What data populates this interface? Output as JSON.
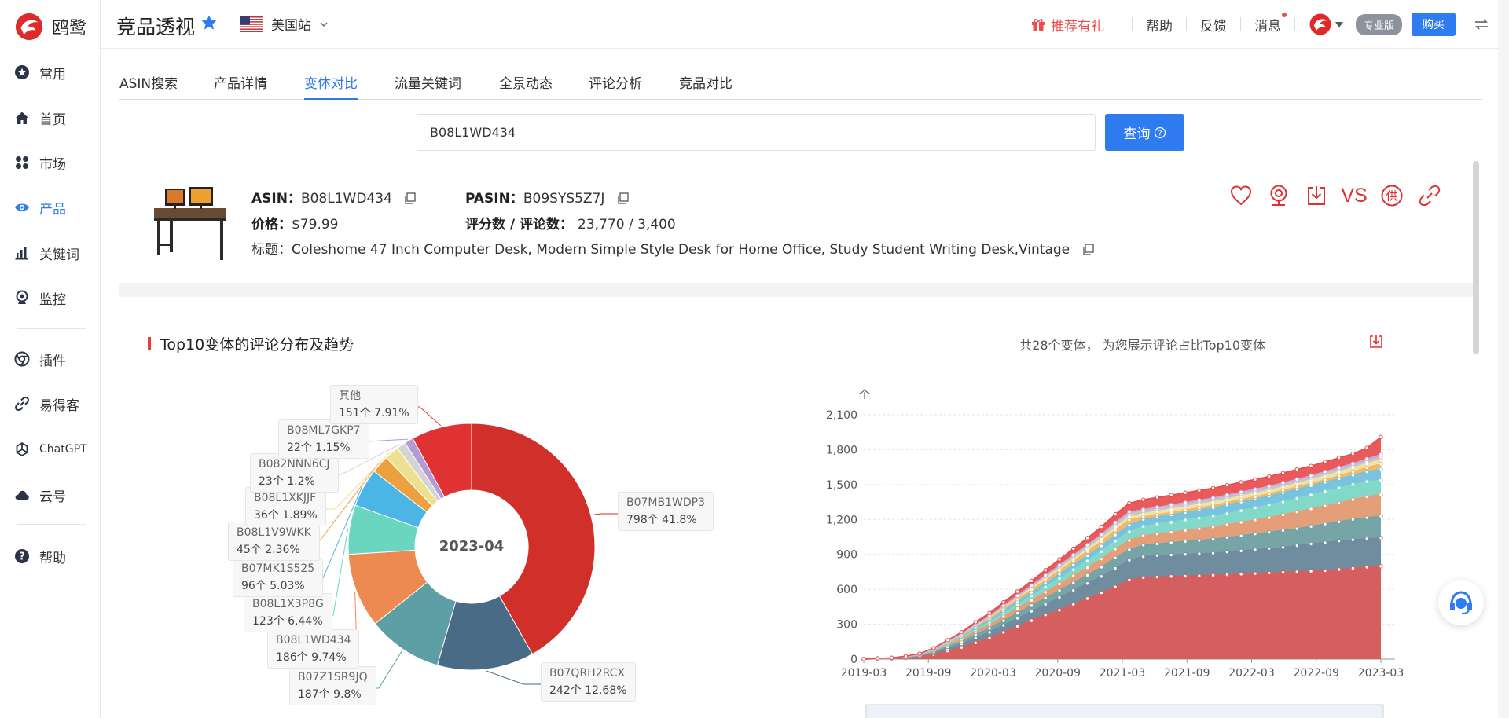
{
  "brand": {
    "name": "鸥鹭"
  },
  "sidebar": {
    "items": [
      {
        "label": "常用",
        "icon": "star-circle-icon"
      },
      {
        "label": "首页",
        "icon": "home-icon"
      },
      {
        "label": "市场",
        "icon": "grid-icon"
      },
      {
        "label": "产品",
        "icon": "eye-icon",
        "active": true
      },
      {
        "label": "关键词",
        "icon": "bar-chart-icon"
      },
      {
        "label": "监控",
        "icon": "webcam-icon"
      },
      {
        "label": "插件",
        "icon": "chrome-icon"
      },
      {
        "label": "易得客",
        "icon": "link-icon"
      },
      {
        "label": "ChatGPT",
        "icon": "openai-icon"
      },
      {
        "label": "云号",
        "icon": "cloud-icon"
      },
      {
        "label": "帮助",
        "icon": "help-icon"
      }
    ]
  },
  "header": {
    "title": "竞品透视",
    "site": "美国站",
    "gift_label": "推荐有礼",
    "help_label": "帮助",
    "feedback_label": "反馈",
    "message_label": "消息",
    "pro_badge": "专业版",
    "buy_label": "购买"
  },
  "tabs": [
    {
      "label": "ASIN搜索"
    },
    {
      "label": "产品详情"
    },
    {
      "label": "变体对比",
      "active": true
    },
    {
      "label": "流量关键词"
    },
    {
      "label": "全景动态"
    },
    {
      "label": "评论分析"
    },
    {
      "label": "竞品对比"
    }
  ],
  "search": {
    "value": "B08L1WD434",
    "button_label": "查询"
  },
  "product": {
    "asin_label": "ASIN：",
    "asin": "B08L1WD434",
    "pasin_label": "PASIN：",
    "pasin": "B09SYS5Z7J",
    "price_label": "价格：",
    "price": "$79.99",
    "reviews_label": "评分数 / 评论数：",
    "reviews": "23,770 / 3,400",
    "title_label": "标题：",
    "title": "Coleshome 47 Inch Computer Desk, Modern Simple Style Desk for Home Office, Study Student Writing Desk,Vintage",
    "actions": {
      "vs_label": "VS"
    }
  },
  "section": {
    "title": "Top10变体的评论分布及趋势",
    "note": "共28个变体， 为您展示评论占比Top10变体"
  },
  "colors": {
    "accent": "#2f7bf0",
    "brand_red": "#e03030"
  },
  "chart_data": [
    {
      "type": "pie",
      "center_label": "2023-04",
      "slices": [
        {
          "name": "B07MB1WDP3",
          "count": "798个",
          "pct": "41.8%",
          "value": 41.8,
          "color": "#d12f2a"
        },
        {
          "name": "B07QRH2RCX",
          "count": "242个",
          "pct": "12.68%",
          "value": 12.68,
          "color": "#4a6b85"
        },
        {
          "name": "B07Z1SR9JQ",
          "count": "187个",
          "pct": "9.8%",
          "value": 9.8,
          "color": "#5e9ea5"
        },
        {
          "name": "B08L1WD434",
          "count": "186个",
          "pct": "9.74%",
          "value": 9.74,
          "color": "#ec8a52"
        },
        {
          "name": "B08L1X3P8G",
          "count": "123个",
          "pct": "6.44%",
          "value": 6.44,
          "color": "#6ad6bf"
        },
        {
          "name": "B07MK1S525",
          "count": "96个",
          "pct": "5.03%",
          "value": 5.03,
          "color": "#4bb5e6"
        },
        {
          "name": "B08L1V9WKK",
          "count": "45个",
          "pct": "2.36%",
          "value": 2.36,
          "color": "#eda13e"
        },
        {
          "name": "B08L1XKJJF",
          "count": "36个",
          "pct": "1.89%",
          "value": 1.89,
          "color": "#ede090"
        },
        {
          "name": "B082NNN6CJ",
          "count": "23个",
          "pct": "1.2%",
          "value": 1.2,
          "color": "#d4d4d4"
        },
        {
          "name": "B08ML7GKP7",
          "count": "22个",
          "pct": "1.15%",
          "value": 1.15,
          "color": "#b49ad6"
        },
        {
          "name": "其他",
          "count": "151个",
          "pct": "7.91%",
          "value": 7.91,
          "color": "#e03232"
        }
      ]
    },
    {
      "type": "area",
      "x_ticks": [
        "2019-03",
        "2019-09",
        "2020-03",
        "2020-09",
        "2021-03",
        "2021-09",
        "2022-03",
        "2022-09",
        "2023-03"
      ],
      "y_ticks": [
        "0",
        "300",
        "600",
        "900",
        "1,200",
        "1,500",
        "1,800",
        "2,100"
      ],
      "y_unit": "个",
      "ylim": [
        0,
        2100
      ],
      "stacked": true,
      "series_totals": [
        {
          "color": "#e05a58",
          "values": [
            0,
            2,
            5,
            10,
            20,
            40,
            70,
            100,
            140,
            180,
            230,
            280,
            330,
            380,
            420,
            470,
            520,
            570,
            620,
            680,
            700,
            705,
            710,
            712,
            715,
            720,
            725,
            730,
            735,
            740,
            745,
            750,
            755,
            760,
            770,
            780,
            790,
            798
          ]
        },
        {
          "color": "#6f8ba0",
          "values": [
            0,
            3,
            6,
            13,
            26,
            52,
            90,
            130,
            180,
            230,
            290,
            350,
            410,
            470,
            530,
            590,
            650,
            710,
            780,
            850,
            880,
            890,
            895,
            900,
            905,
            910,
            920,
            930,
            940,
            950,
            960,
            975,
            990,
            1000,
            1015,
            1025,
            1035,
            1040
          ]
        },
        {
          "color": "#6aa5ab",
          "values": [
            0,
            3,
            7,
            15,
            30,
            60,
            105,
            150,
            210,
            265,
            330,
            395,
            460,
            525,
            590,
            655,
            720,
            790,
            870,
            940,
            980,
            990,
            1000,
            1010,
            1020,
            1030,
            1045,
            1060,
            1075,
            1090,
            1105,
            1120,
            1140,
            1160,
            1180,
            1200,
            1215,
            1227
          ]
        },
        {
          "color": "#ee9870",
          "values": [
            0,
            4,
            8,
            17,
            34,
            68,
            118,
            170,
            235,
            295,
            365,
            435,
            505,
            575,
            645,
            715,
            785,
            860,
            945,
            1020,
            1060,
            1075,
            1090,
            1105,
            1120,
            1135,
            1155,
            1175,
            1195,
            1215,
            1240,
            1265,
            1290,
            1315,
            1340,
            1370,
            1395,
            1413
          ]
        },
        {
          "color": "#84dcc7",
          "values": [
            0,
            4,
            9,
            19,
            37,
            74,
            128,
            184,
            254,
            318,
            393,
            468,
            543,
            618,
            693,
            768,
            843,
            923,
            1013,
            1093,
            1140,
            1160,
            1175,
            1195,
            1210,
            1230,
            1250,
            1275,
            1300,
            1325,
            1350,
            1380,
            1410,
            1440,
            1470,
            1500,
            1525,
            1536
          ]
        },
        {
          "color": "#6cc4ec",
          "values": [
            0,
            4,
            9,
            20,
            39,
            78,
            135,
            194,
            268,
            335,
            414,
            493,
            572,
            651,
            730,
            809,
            888,
            972,
            1066,
            1150,
            1200,
            1220,
            1240,
            1260,
            1280,
            1300,
            1325,
            1350,
            1375,
            1400,
            1430,
            1460,
            1490,
            1520,
            1550,
            1580,
            1610,
            1632
          ]
        },
        {
          "color": "#f2b560",
          "values": [
            0,
            5,
            10,
            21,
            41,
            82,
            141,
            203,
            280,
            350,
            432,
            514,
            596,
            678,
            760,
            842,
            924,
            1010,
            1108,
            1195,
            1220,
            1240,
            1260,
            1280,
            1300,
            1320,
            1345,
            1370,
            1395,
            1420,
            1450,
            1480,
            1510,
            1540,
            1575,
            1610,
            1645,
            1677
          ]
        },
        {
          "color": "#f0e6a8",
          "values": [
            0,
            5,
            10,
            22,
            42,
            84,
            145,
            208,
            287,
            359,
            443,
            527,
            611,
            695,
            779,
            863,
            947,
            1035,
            1135,
            1224,
            1250,
            1270,
            1290,
            1310,
            1330,
            1350,
            1375,
            1400,
            1425,
            1450,
            1480,
            1510,
            1540,
            1575,
            1610,
            1645,
            1680,
            1713
          ]
        },
        {
          "color": "#c7c7c7",
          "values": [
            0,
            5,
            11,
            22,
            43,
            86,
            148,
            212,
            292,
            365,
            451,
            537,
            623,
            709,
            795,
            881,
            967,
            1057,
            1158,
            1249,
            1270,
            1290,
            1310,
            1330,
            1350,
            1370,
            1395,
            1420,
            1445,
            1470,
            1500,
            1530,
            1560,
            1595,
            1630,
            1665,
            1700,
            1736
          ]
        },
        {
          "color": "#c3b0e2",
          "values": [
            0,
            5,
            11,
            23,
            44,
            88,
            151,
            216,
            297,
            371,
            458,
            545,
            632,
            719,
            806,
            893,
            980,
            1071,
            1173,
            1265,
            1285,
            1305,
            1325,
            1345,
            1365,
            1385,
            1410,
            1435,
            1460,
            1485,
            1515,
            1545,
            1575,
            1610,
            1645,
            1680,
            1720,
            1758
          ]
        },
        {
          "color": "#e84848",
          "values": [
            0,
            6,
            12,
            25,
            48,
            95,
            163,
            232,
            318,
            397,
            489,
            581,
            673,
            765,
            857,
            949,
            1041,
            1137,
            1245,
            1340,
            1370,
            1390,
            1410,
            1430,
            1450,
            1470,
            1495,
            1520,
            1545,
            1570,
            1600,
            1630,
            1660,
            1695,
            1730,
            1765,
            1815,
            1909
          ]
        }
      ]
    }
  ]
}
